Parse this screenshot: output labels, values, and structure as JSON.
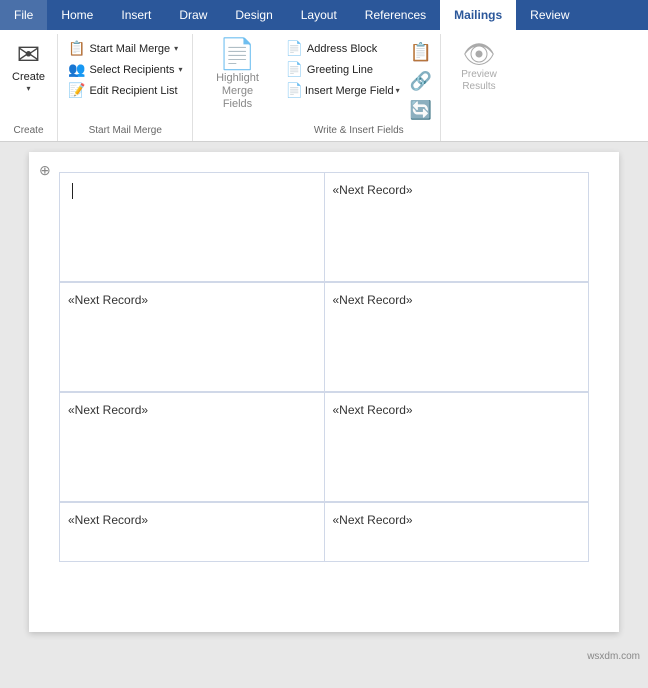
{
  "tabs": [
    {
      "label": "File",
      "active": false
    },
    {
      "label": "Home",
      "active": false
    },
    {
      "label": "Insert",
      "active": false
    },
    {
      "label": "Draw",
      "active": false
    },
    {
      "label": "Design",
      "active": false
    },
    {
      "label": "Layout",
      "active": false
    },
    {
      "label": "References",
      "active": false
    },
    {
      "label": "Mailings",
      "active": true
    },
    {
      "label": "Review",
      "active": false
    }
  ],
  "groups": {
    "create": {
      "label": "Create",
      "create_btn": "Create",
      "icon": "✉"
    },
    "start_mail_merge": {
      "label": "Start Mail Merge",
      "buttons": [
        {
          "id": "start-mail-merge",
          "icon": "📋",
          "label": "Start Mail Merge",
          "chevron": true
        },
        {
          "id": "select-recipients",
          "icon": "👥",
          "label": "Select Recipients",
          "chevron": true
        },
        {
          "id": "edit-recipient-list",
          "icon": "📝",
          "label": "Edit Recipient List"
        }
      ]
    },
    "highlight": {
      "label": "Highlight\nMerge Fields",
      "icon": "📄"
    },
    "write_insert": {
      "label": "Write & Insert Fields",
      "buttons": [
        {
          "id": "address-block",
          "icon": "📄",
          "label": "Address Block",
          "chevron": false
        },
        {
          "id": "greeting-line",
          "icon": "📄",
          "label": "Greeting Line",
          "chevron": false
        },
        {
          "id": "insert-merge-field",
          "icon": "📄",
          "label": "Insert Merge Field",
          "chevron": true
        }
      ],
      "right_buttons": [
        {
          "id": "rules",
          "icon": "📋"
        },
        {
          "id": "match-fields",
          "icon": "🔗"
        },
        {
          "id": "update-labels",
          "icon": "🔄"
        }
      ]
    },
    "preview": {
      "label": "Preview\nResults"
    }
  },
  "document": {
    "next_record_text": "«Next Record»",
    "cells": [
      {
        "row": 0,
        "col": 0,
        "has_cursor": true,
        "has_record": false
      },
      {
        "row": 0,
        "col": 1,
        "has_cursor": false,
        "has_record": true
      },
      {
        "row": 1,
        "col": 0,
        "has_cursor": false,
        "has_record": true
      },
      {
        "row": 1,
        "col": 1,
        "has_cursor": false,
        "has_record": true
      },
      {
        "row": 2,
        "col": 0,
        "has_cursor": false,
        "has_record": true
      },
      {
        "row": 2,
        "col": 1,
        "has_cursor": false,
        "has_record": true
      },
      {
        "row": 3,
        "col": 0,
        "has_cursor": false,
        "has_record": true
      },
      {
        "row": 3,
        "col": 1,
        "has_cursor": false,
        "has_record": true
      }
    ]
  },
  "watermark": "wsxdm.com"
}
